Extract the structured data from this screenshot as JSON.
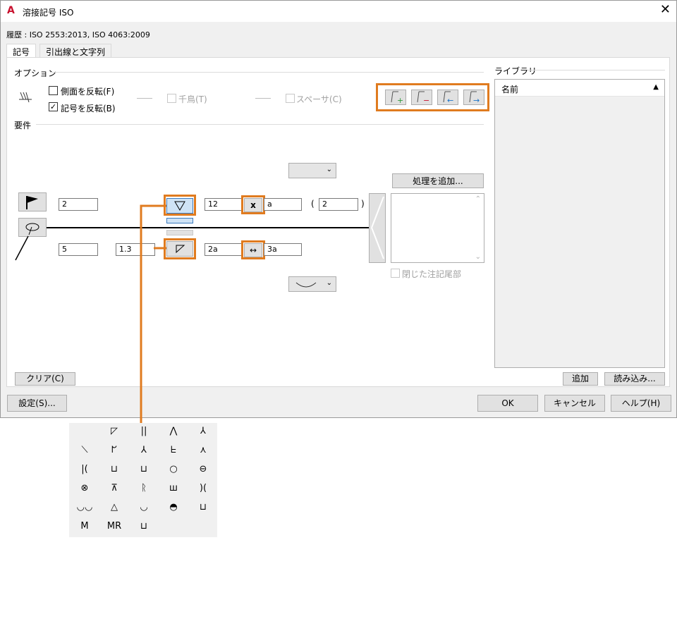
{
  "window": {
    "title": "溶接記号 ISO",
    "history": "履歴 : ISO 2553:2013, ISO 4063:2009"
  },
  "tabs": [
    {
      "label": "記号"
    },
    {
      "label": "引出線と文字列"
    }
  ],
  "options": {
    "label": "オプション",
    "flip_side": "側面を反転(F)",
    "flip_symbol": "記号を反転(B)",
    "stagger": "千鳥(T)",
    "spacer": "スペーサ(C)"
  },
  "elements": {
    "label": "要件"
  },
  "fields": {
    "top_left": "2",
    "top_size": "12",
    "top_a": "a",
    "top_paren": "2",
    "bottom_left": "5",
    "bottom_mid": "1.3",
    "bottom_size": "2a",
    "bottom_a": "3a"
  },
  "paren_open": "(",
  "paren_close": ")",
  "add_process": "処理を追加...",
  "closed_tail": "閉じた注記尾部",
  "library": {
    "label": "ライブラリ",
    "column": "名前"
  },
  "buttons": {
    "clear": "クリア(C)",
    "add": "追加",
    "load": "読み込み...",
    "settings": "設定(S)...",
    "ok": "OK",
    "cancel": "キャンセル",
    "help": "ヘルプ(H)"
  },
  "symbol_grid": [
    [
      "",
      "◸",
      "||",
      "⋀",
      "⅄"
    ],
    [
      "⟍",
      "ᖸ",
      "⅄",
      "ᖶ",
      "⋏"
    ],
    [
      "|(",
      "⊔",
      "⊔",
      "○",
      "⊖"
    ],
    [
      "⊗",
      "⊼",
      "ᚱ",
      "ш",
      ")("
    ],
    [
      "◡◡",
      "△",
      "◡",
      "◓",
      "⊔"
    ],
    [
      "M",
      "MR",
      "⊔",
      "",
      ""
    ]
  ],
  "colors": {
    "highlight": "#e07b1f",
    "dialog_bg": "#f0f0f0"
  }
}
